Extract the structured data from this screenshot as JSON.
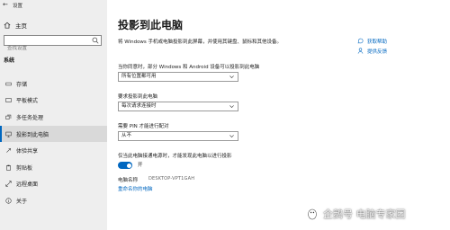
{
  "window": {
    "title": "设置"
  },
  "sidebar": {
    "home_label": "主页",
    "search_placeholder": "查找设置",
    "section_title": "系统",
    "items": [
      {
        "label": "存储",
        "icon": "storage-icon"
      },
      {
        "label": "平板模式",
        "icon": "tablet-mode-icon"
      },
      {
        "label": "多任务处理",
        "icon": "multitasking-icon"
      },
      {
        "label": "投影到此电脑",
        "icon": "project-to-pc-icon",
        "active": true
      },
      {
        "label": "体验共享",
        "icon": "shared-experiences-icon"
      },
      {
        "label": "剪贴板",
        "icon": "clipboard-icon"
      },
      {
        "label": "远程桌面",
        "icon": "remote-desktop-icon"
      },
      {
        "label": "关于",
        "icon": "about-icon"
      }
    ]
  },
  "main": {
    "title": "投影到此电脑",
    "description": "将 Windows 手机或电脑投影到此屏幕，并使用其键盘、鼠标和其他设备。",
    "setting1": {
      "label": "当你同意时，部分 Windows 和 Android 设备可以投影到此电脑",
      "value": "所有位置都可用"
    },
    "setting2": {
      "label": "要求投影到此电脑",
      "value": "每次请求连接时"
    },
    "setting3": {
      "label": "需要 PIN 才能进行配对",
      "value": "从不"
    },
    "power": {
      "label": "仅当此电脑接通电源时，才能发现此电脑以进行投影",
      "toggle_text": "开",
      "toggle_on": true
    },
    "pc_name_label": "电脑名称",
    "pc_name_value": "DESKTOP-VPT1GAH",
    "rename_link": "重命名你的电脑"
  },
  "help_links": [
    {
      "label": "获取帮助",
      "icon": "help-icon"
    },
    {
      "label": "提供反馈",
      "icon": "feedback-icon"
    }
  ],
  "watermark": {
    "text": "企鹅号 电脑专家团"
  },
  "colors": {
    "accent": "#0067c0",
    "sidebar_bg": "#eeeeee"
  }
}
